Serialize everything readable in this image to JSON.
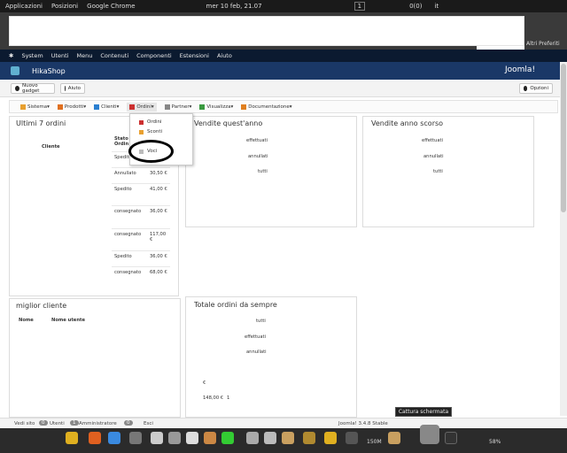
{
  "top_bar": {
    "applications": "Applicazioni",
    "positions": "Posizioni",
    "browser": "Google Chrome",
    "datetime": "mer 10 feb, 21.07",
    "workspace": "1",
    "counter": "0(0)",
    "language": "it"
  },
  "joomla_menu": [
    "System",
    "Utenti",
    "Menu",
    "Contenuti",
    "Componenti",
    "Estensioni",
    "Aiuto"
  ],
  "header": {
    "title": "HikaShop",
    "brand": "Joomla!",
    "other_bookmarks": "Altri Preferiti"
  },
  "toolbar": {
    "new_gadget": "Nuovo gadget",
    "help": "Aiuto",
    "options": "Opzioni"
  },
  "hika_menu": [
    {
      "label": "Sistema",
      "color": "#e8a030"
    },
    {
      "label": "Prodotti",
      "color": "#e07020"
    },
    {
      "label": "Clienti",
      "color": "#2a7fd0"
    },
    {
      "label": "Ordini",
      "color": "#cc3030"
    },
    {
      "label": "Partner",
      "color": "#888888"
    },
    {
      "label": "Visualizza",
      "color": "#3a9a40"
    },
    {
      "label": "Documentazione",
      "color": "#e08020"
    }
  ],
  "orders_dropdown": [
    "Ordini",
    "Sconti",
    "Voci"
  ],
  "panels": {
    "last_orders": {
      "title": "Ultimi 7 ordini",
      "col_customer": "Cliente",
      "col_status": "Stato\nOrdin"
    },
    "sales_this_year": {
      "title": "Vendite quest'anno",
      "rows": [
        "effettuati",
        "annullati",
        "tutti"
      ]
    },
    "sales_last_year": {
      "title": "Vendite anno scorso",
      "rows": [
        "effettuati",
        "annullati",
        "tutti"
      ]
    },
    "best_customer": {
      "title": "miglior cliente",
      "col_name": "Nome",
      "col_username": "Nome utente"
    },
    "total_orders": {
      "title": "Totale ordini da sempre",
      "rows": [
        "tutti",
        "effettuati",
        "annullati"
      ],
      "currency": "€",
      "amount": "148,00 €",
      "count": "1"
    }
  },
  "orders_rows": [
    {
      "status": "Spedito",
      "amount": ""
    },
    {
      "status": "Annullato",
      "amount": "30,50 €"
    },
    {
      "status": "Spedito",
      "amount": "41,00 €"
    },
    {
      "status": "consegnato",
      "amount": "36,00 €"
    },
    {
      "status": "consegnato",
      "amount": "117,00 €"
    },
    {
      "status": "Spedito",
      "amount": "36,00 €"
    },
    {
      "status": "consegnato",
      "amount": "68,00 €"
    }
  ],
  "status_bar": {
    "view_site": "Vedi sito",
    "visitors_count": "0",
    "visitors": "Utenti",
    "admins_count": "1",
    "admins": "Amministratore",
    "messages_count": "0",
    "logout": "Esci",
    "version": "Joomla! 3.4.8 Stable"
  },
  "tooltip": "Cattura schermata",
  "taskbar": {
    "memory": "150M",
    "battery": "58%"
  }
}
